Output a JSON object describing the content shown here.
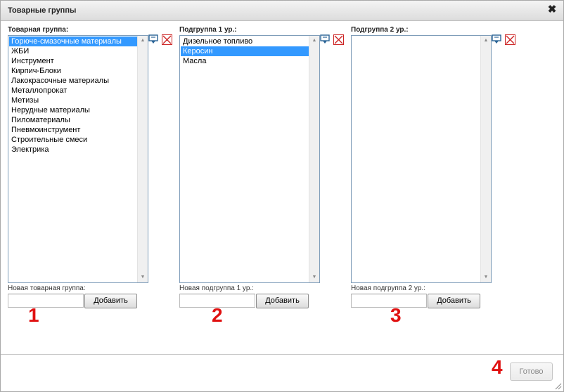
{
  "dialog": {
    "title": "Товарные группы",
    "close_icon": "close-icon"
  },
  "group": {
    "label": "Товарная группа:",
    "items": [
      "Горюче-смазочные материалы",
      "ЖБИ",
      "Инструмент",
      "Кирпич-Блоки",
      "Лакокрасочные материалы",
      "Металлопрокат",
      "Метизы",
      "Нерудные материалы",
      "Пиломатериалы",
      "Пневмоинструмент",
      "Строительные смеси",
      "Электрика"
    ],
    "selected": "Горюче-смазочные материалы",
    "new_label": "Новая товарная группа:",
    "new_value": "",
    "add_label": "Добавить",
    "marker": "1"
  },
  "sub1": {
    "label": "Подгруппа 1 ур.:",
    "items": [
      "Дизельное топливо",
      "Керосин",
      "Масла"
    ],
    "selected": "Керосин",
    "new_label": "Новая подгруппа 1 ур.:",
    "new_value": "",
    "add_label": "Добавить",
    "marker": "2"
  },
  "sub2": {
    "label": "Подгруппа 2 ур.:",
    "items": [],
    "new_label": "Новая подгруппа 2 ур.:",
    "new_value": "",
    "add_label": "Добавить",
    "marker": "3"
  },
  "footer": {
    "done_label": "Готово",
    "marker": "4"
  },
  "colors": {
    "selection": "#3399ff",
    "marker": "#e01010",
    "delete": "#cc2222",
    "edit": "#2a6496"
  },
  "icons": {
    "edit": "edit-icon",
    "delete": "delete-icon"
  }
}
